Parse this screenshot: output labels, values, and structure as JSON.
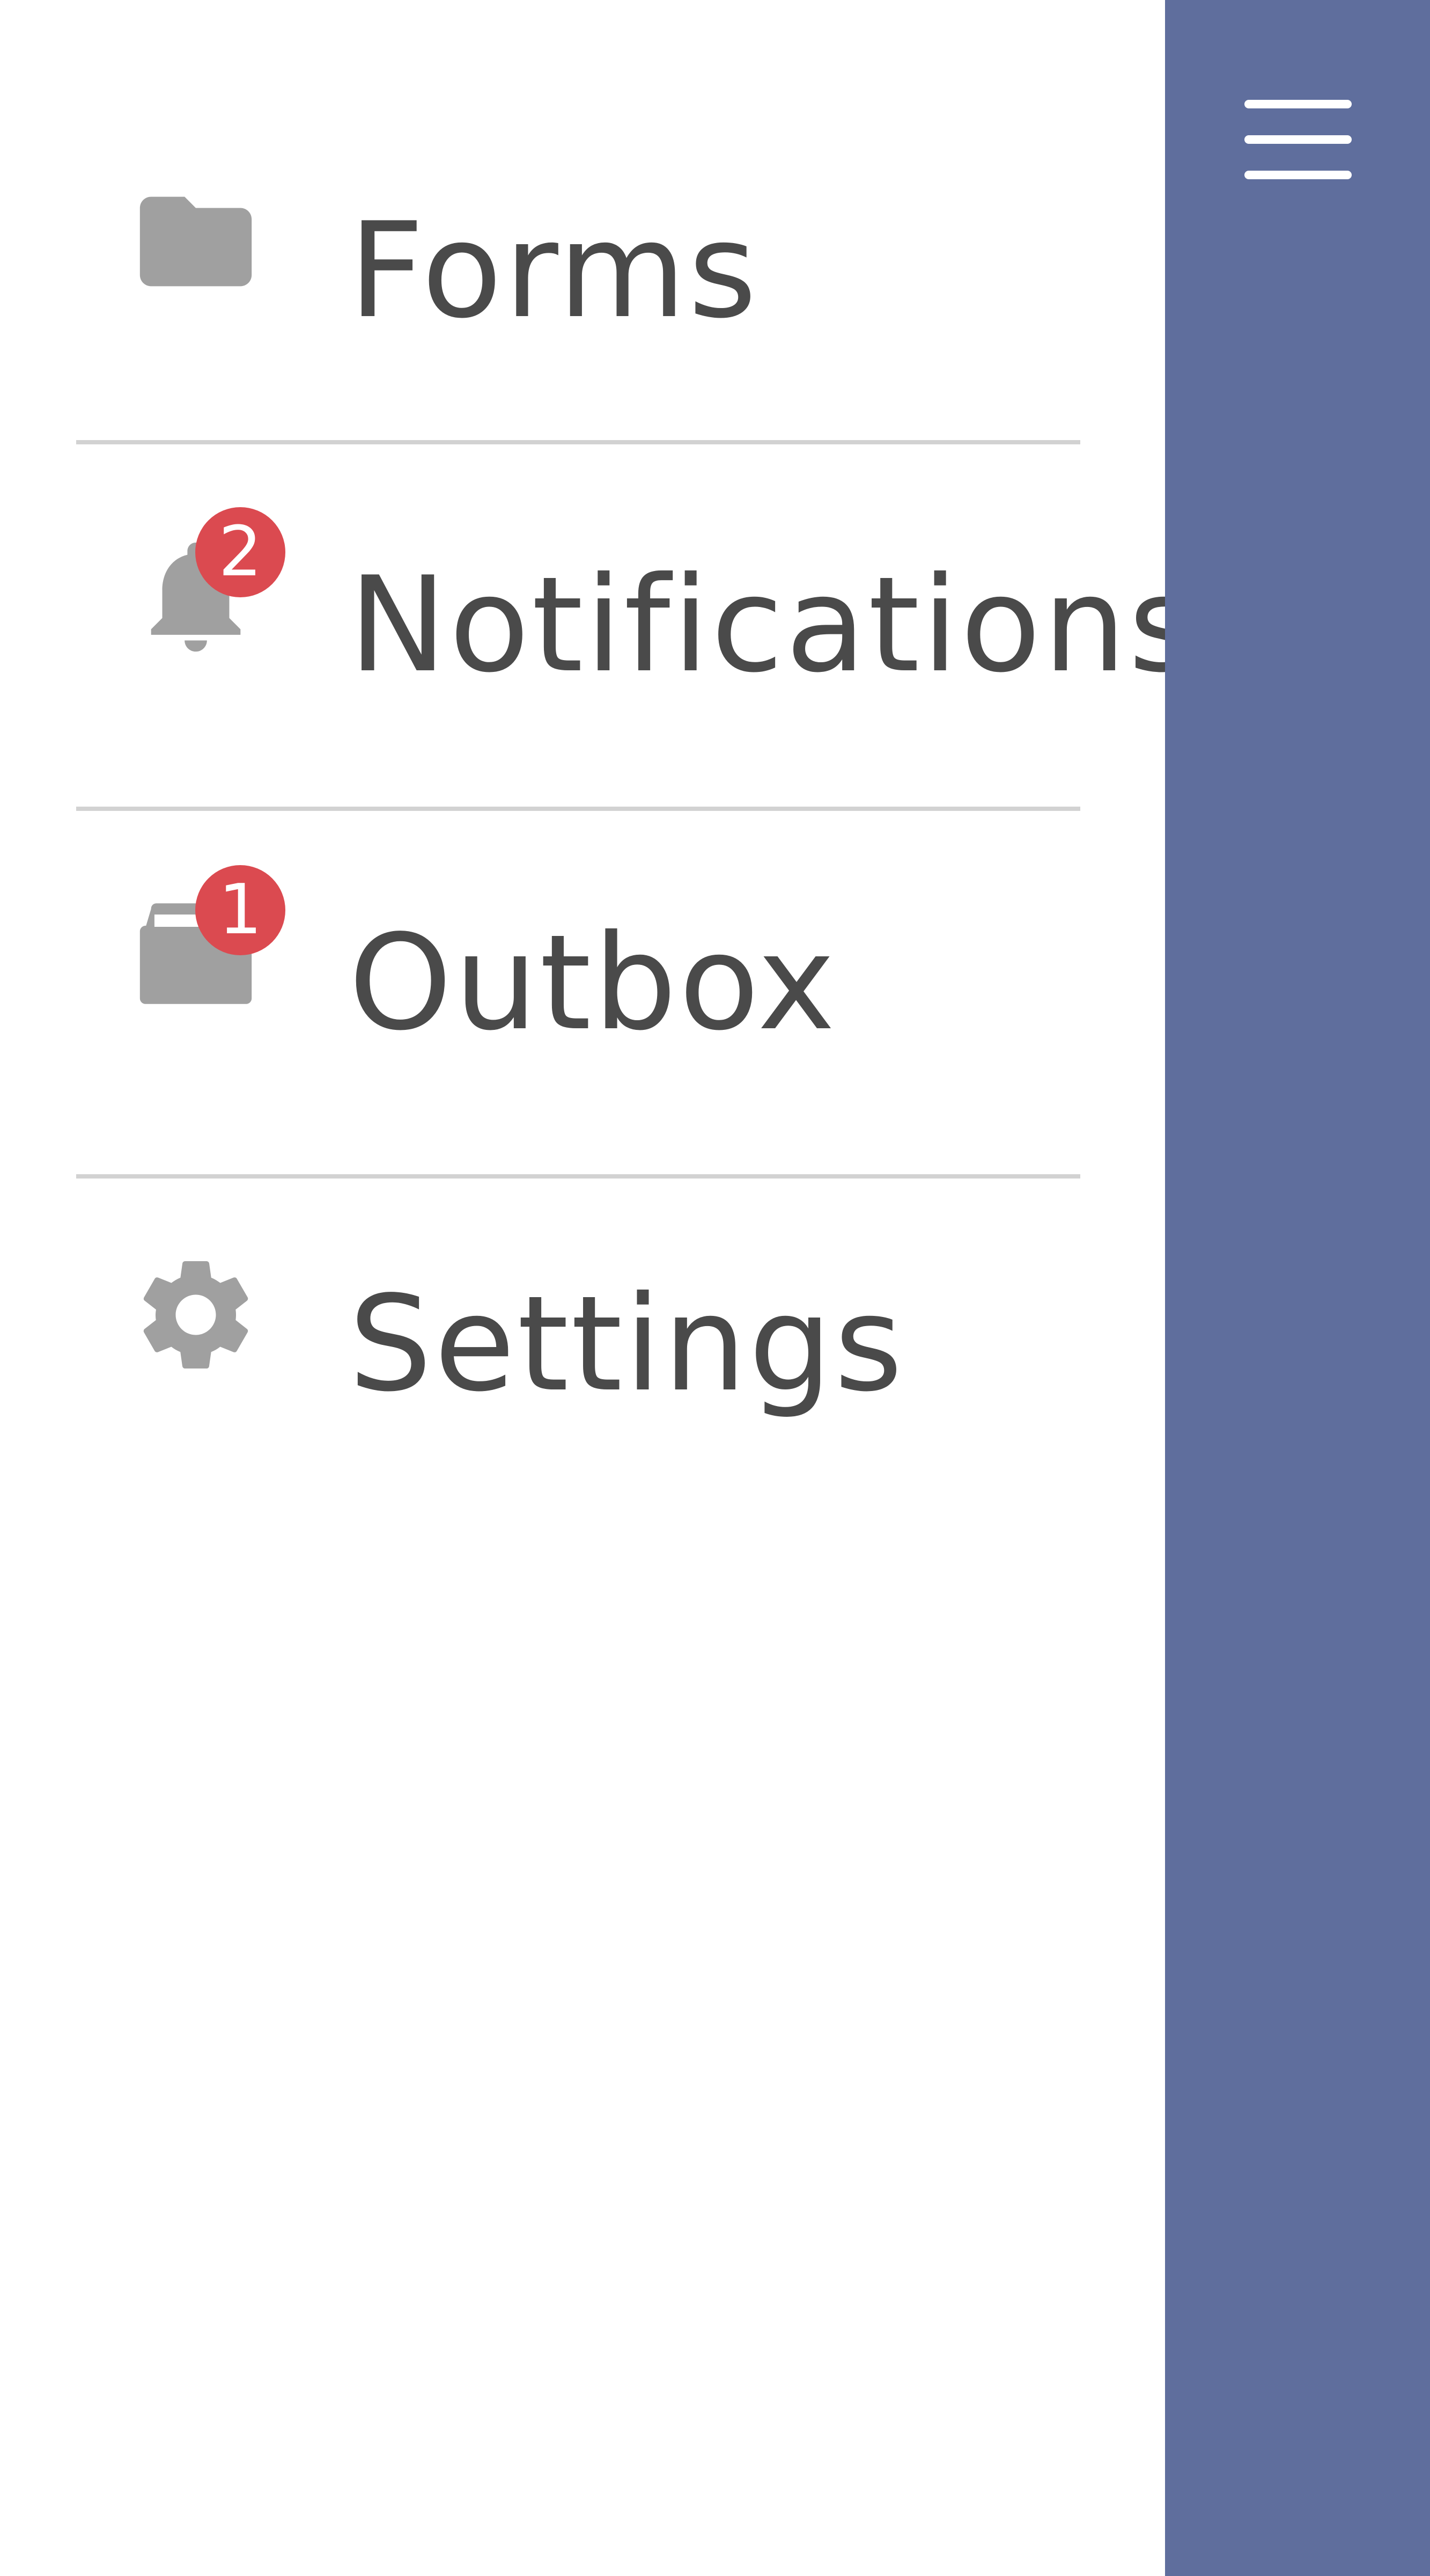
{
  "drawer": {
    "items": [
      {
        "label": "Forms",
        "icon": "folder-icon",
        "badge": null
      },
      {
        "label": "Notifications",
        "icon": "bell-icon",
        "badge": "2"
      },
      {
        "label": "Outbox",
        "icon": "outbox-icon",
        "badge": "1"
      },
      {
        "label": "Settings",
        "icon": "gear-icon",
        "badge": null
      }
    ]
  },
  "header": {
    "menu_icon": "hamburger-menu-icon"
  },
  "colors": {
    "side_panel": "#5f6e9d",
    "badge": "#db4a50",
    "icon": "#a0a0a0",
    "label_text": "#4a4a4a",
    "divider": "#d2d2d2",
    "background": "#ffffff"
  }
}
